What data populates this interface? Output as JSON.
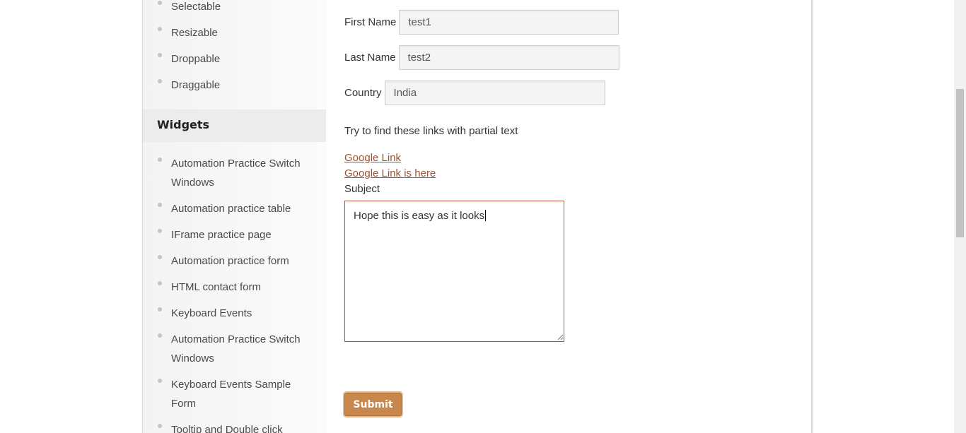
{
  "sidebar": {
    "top_items": [
      {
        "label": "Selectable"
      },
      {
        "label": "Resizable"
      },
      {
        "label": "Droppable"
      },
      {
        "label": "Draggable"
      }
    ],
    "widgets_heading": "Widgets",
    "widget_items": [
      {
        "label": "Automation Practice Switch Windows"
      },
      {
        "label": "Automation practice table"
      },
      {
        "label": "IFrame practice page"
      },
      {
        "label": "Automation practice form"
      },
      {
        "label": "HTML contact form"
      },
      {
        "label": "Keyboard Events"
      },
      {
        "label": "Automation Practice Switch Windows"
      },
      {
        "label": "Keyboard Events Sample Form"
      },
      {
        "label": "Tooltip and Double click"
      }
    ]
  },
  "form": {
    "first_name_label": "First Name",
    "first_name_value": "test1",
    "last_name_label": "Last Name",
    "last_name_value": "test2",
    "country_label": "Country",
    "country_value": "India",
    "partial_text_heading": "Try to find these links with partial text",
    "link_1": "Google Link",
    "link_2": "Google Link is here",
    "subject_label": "Subject",
    "subject_value": "Hope this is easy as it looks",
    "submit_label": "Submit"
  },
  "colors": {
    "link": "#a0522d",
    "submit_bg": "#c8874d",
    "textarea_border": "#b5533b"
  }
}
